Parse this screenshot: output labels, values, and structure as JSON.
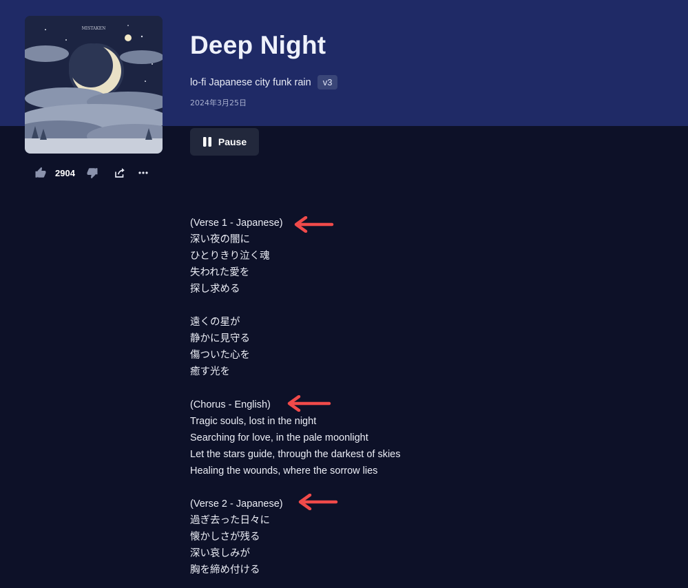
{
  "song": {
    "title": "Deep Night",
    "style": "lo-fi Japanese city funk rain",
    "version": "v3",
    "date": "2024年3月25日",
    "cover_text": "MISTAKEN"
  },
  "actions": {
    "like_count": "2904",
    "pause_label": "Pause"
  },
  "lyrics": {
    "verse1": {
      "heading": "(Verse 1 - Japanese)",
      "lines": [
        "深い夜の闇に",
        "ひとりきり泣く魂",
        "失われた愛を",
        "探し求める"
      ]
    },
    "verse1b": {
      "lines": [
        "遠くの星が",
        "静かに見守る",
        "傷ついた心を",
        "癒す光を"
      ]
    },
    "chorus": {
      "heading": "(Chorus - English)",
      "lines": [
        "Tragic souls, lost in the night",
        "Searching for love, in the pale moonlight",
        "Let the stars guide, through the darkest of skies",
        "Healing the wounds, where the sorrow lies"
      ]
    },
    "verse2": {
      "heading": "(Verse 2 - Japanese)",
      "lines": [
        "過ぎ去った日々に",
        "懐かしさが残る",
        "深い哀しみが",
        "胸を締め付ける"
      ]
    }
  },
  "colors": {
    "header_bg": "#1f2a66",
    "page_bg": "#0d1128",
    "annotation_arrow": "#f04a4a",
    "badge_bg": "#3a4678"
  }
}
